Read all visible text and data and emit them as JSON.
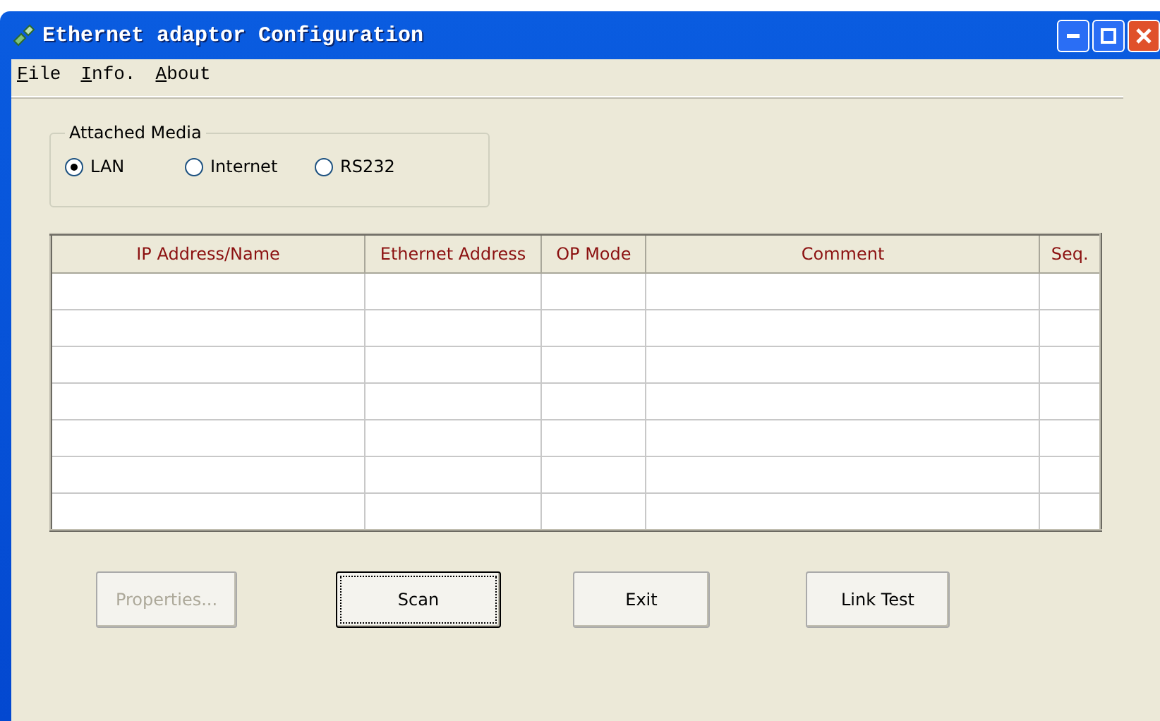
{
  "window": {
    "title": "Ethernet adaptor Configuration"
  },
  "menu": [
    {
      "label": "File"
    },
    {
      "label": "Info."
    },
    {
      "label": "About"
    }
  ],
  "attached_media": {
    "title": "Attached Media",
    "options": [
      {
        "label": "LAN",
        "selected": true
      },
      {
        "label": "Internet",
        "selected": false
      },
      {
        "label": "RS232",
        "selected": false
      }
    ]
  },
  "table": {
    "columns": [
      "IP Address/Name",
      "Ethernet Address",
      "OP Mode",
      "Comment",
      "Seq."
    ]
  },
  "buttons": [
    {
      "label": "Properties...",
      "disabled": true,
      "focused": false
    },
    {
      "label": "Scan",
      "disabled": false,
      "focused": true
    },
    {
      "label": "Exit",
      "disabled": false,
      "focused": false
    },
    {
      "label": "Link Test",
      "disabled": false,
      "focused": false
    }
  ]
}
